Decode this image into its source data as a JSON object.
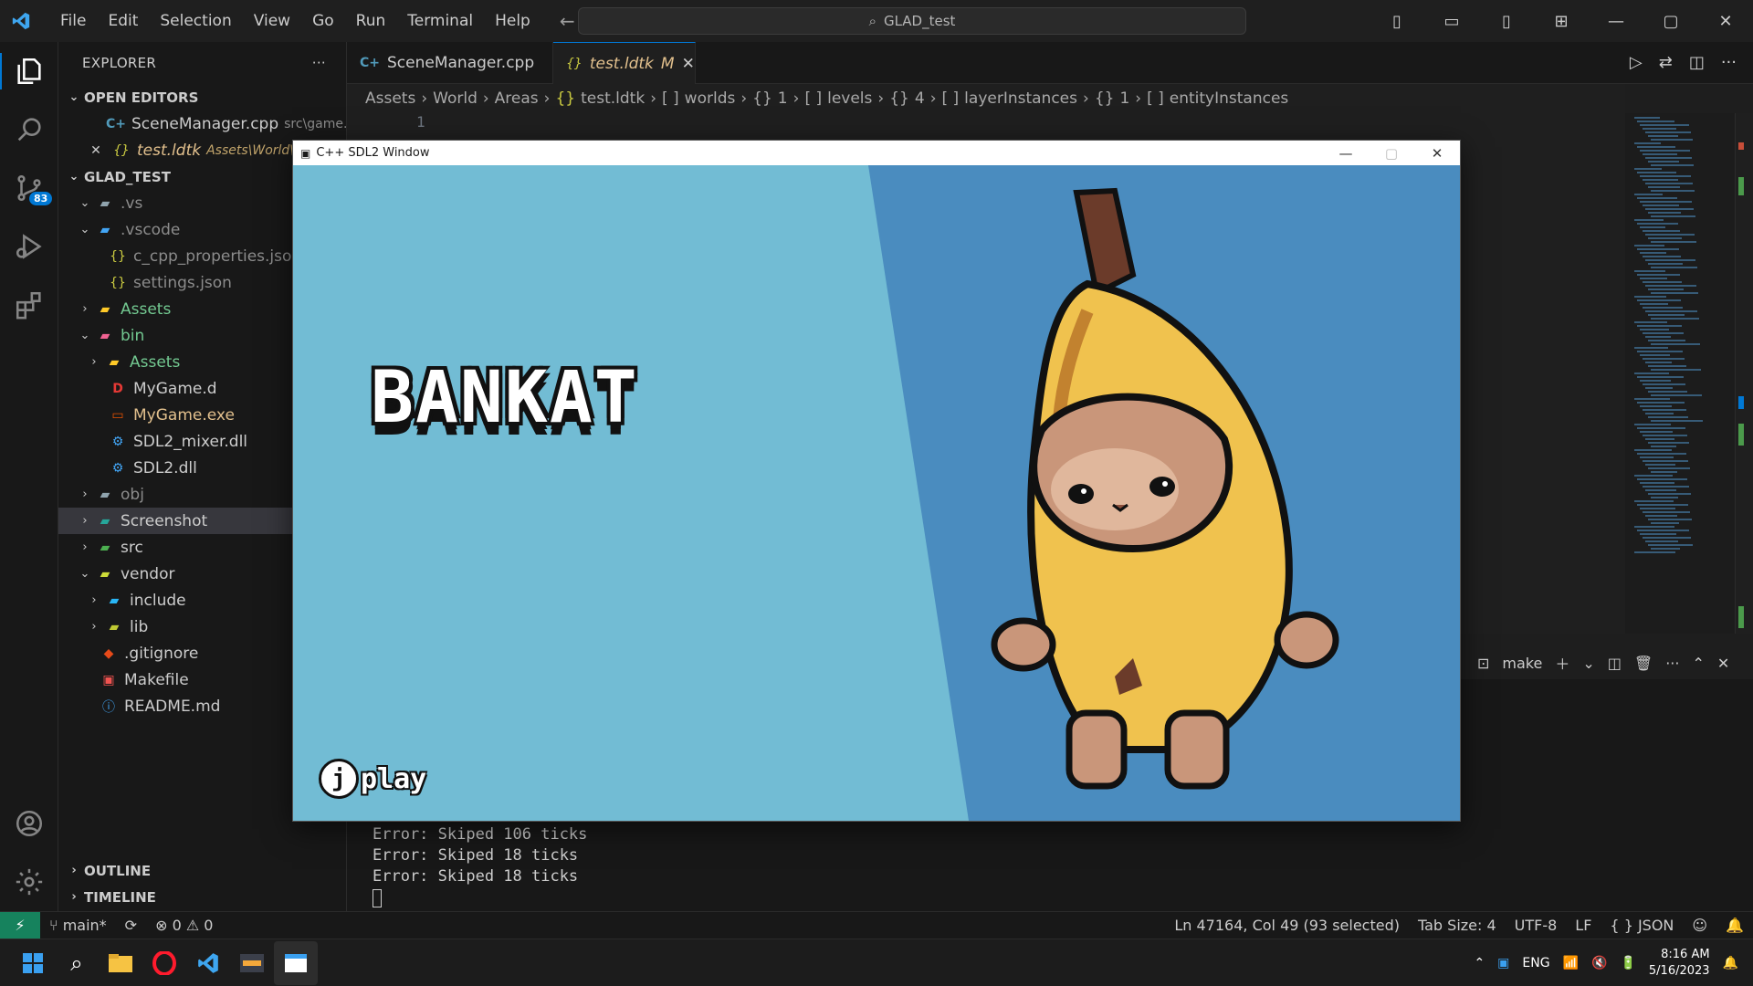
{
  "titlebar": {
    "menu": [
      "File",
      "Edit",
      "Selection",
      "View",
      "Go",
      "Run",
      "Terminal",
      "Help"
    ],
    "search": "GLAD_test"
  },
  "activity": {
    "scm_badge": "83"
  },
  "sidebar": {
    "title": "EXPLORER",
    "open_editors_label": "OPEN EDITORS",
    "open_editors": [
      {
        "name": "SceneManager.cpp",
        "path": "src\\game..."
      },
      {
        "name": "test.ldtk",
        "path": "Assets\\World\\A..."
      }
    ],
    "project_label": "GLAD_TEST",
    "tree": [
      {
        "name": ".vs"
      },
      {
        "name": ".vscode"
      },
      {
        "name": "c_cpp_properties.json"
      },
      {
        "name": "settings.json"
      },
      {
        "name": "Assets"
      },
      {
        "name": "bin"
      },
      {
        "name": "Assets"
      },
      {
        "name": "MyGame.d"
      },
      {
        "name": "MyGame.exe"
      },
      {
        "name": "SDL2_mixer.dll"
      },
      {
        "name": "SDL2.dll"
      },
      {
        "name": "obj"
      },
      {
        "name": "Screenshot"
      },
      {
        "name": "src"
      },
      {
        "name": "vendor"
      },
      {
        "name": "include"
      },
      {
        "name": "lib"
      },
      {
        "name": ".gitignore"
      },
      {
        "name": "Makefile"
      },
      {
        "name": "README.md"
      }
    ],
    "outline_label": "OUTLINE",
    "timeline_label": "TIMELINE"
  },
  "tabs": [
    {
      "label": "SceneManager.cpp"
    },
    {
      "label": "test.ldtk",
      "modified": "M"
    }
  ],
  "breadcrumb": [
    "Assets",
    "World",
    "Areas",
    "test.ldtk",
    "worlds",
    "1",
    "levels",
    "4",
    "layerInstances",
    "1",
    "entityInstances"
  ],
  "editor": {
    "first_line": "1"
  },
  "panel": {
    "terminal_name": "make"
  },
  "terminal": {
    "lines": [
      "Error: Skiped 106 ticks",
      "Error: Skiped 18 ticks",
      "Error: Skiped 18 ticks"
    ]
  },
  "sdl": {
    "title": "C++ SDL2 Window",
    "game_title": "BANKAT",
    "key": "j",
    "play_label": "play",
    "colors": {
      "bg_light": "#72bcd4",
      "bg_dark": "#4a8cbf",
      "banana": "#f0c24e",
      "cat": "#c9967a"
    }
  },
  "statusbar": {
    "branch": "main*",
    "errors": "0",
    "warnings": "0",
    "position": "Ln 47164, Col 49 (93 selected)",
    "tab_size": "Tab Size: 4",
    "encoding": "UTF-8",
    "eol": "LF",
    "language": "JSON"
  },
  "taskbar": {
    "lang": "ENG",
    "time": "8:16 AM",
    "date": "5/16/2023"
  }
}
